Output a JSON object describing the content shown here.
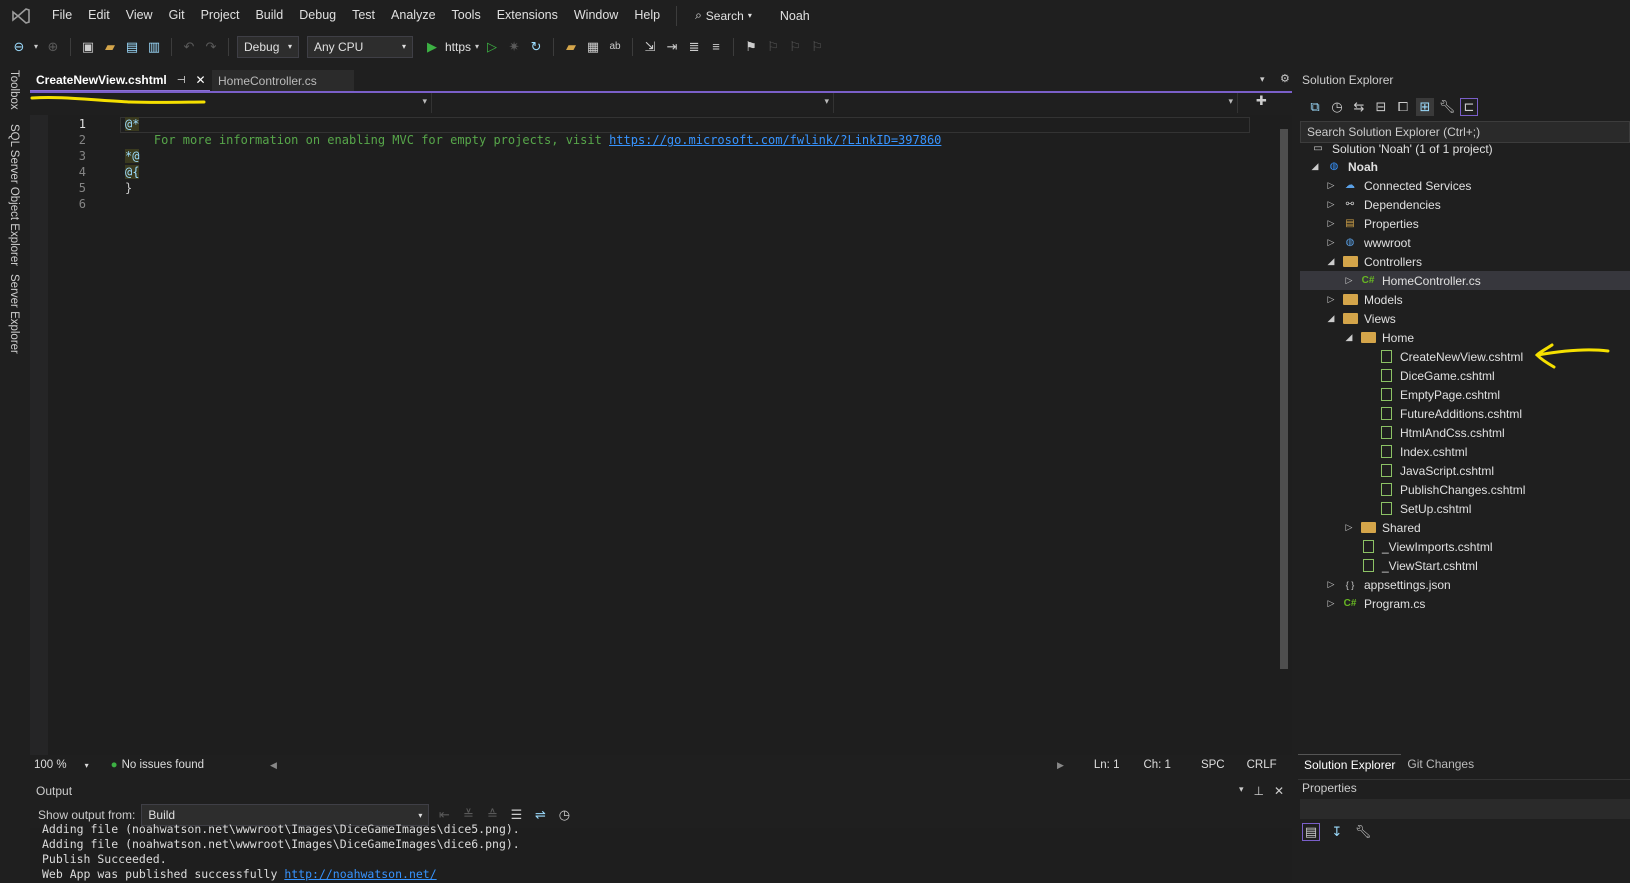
{
  "menubar": {
    "items": [
      "File",
      "Edit",
      "View",
      "Git",
      "Project",
      "Build",
      "Debug",
      "Test",
      "Analyze",
      "Tools",
      "Extensions",
      "Window",
      "Help"
    ],
    "search_label": "Search",
    "solution_name": "Noah"
  },
  "toolbar": {
    "config": "Debug",
    "platform": "Any CPU",
    "run_target": "https"
  },
  "left_tabs": [
    "Toolbox",
    "SQL Server Object Explorer",
    "Server Explorer"
  ],
  "editor": {
    "tabs": [
      {
        "label": "CreateNewView.cshtml",
        "active": true
      },
      {
        "label": "HomeController.cs",
        "active": false
      }
    ],
    "line_numbers": [
      "1",
      "2",
      "3",
      "4",
      "5",
      "6"
    ],
    "lines": {
      "l1": "@*",
      "l2_text": "    For more information on enabling MVC for empty projects, visit ",
      "l2_link": "https://go.microsoft.com/fwlink/?LinkID=397860",
      "l3": "*@",
      "l4": "@{",
      "l5": "}"
    },
    "status": {
      "zoom": "100 %",
      "issues": "No issues found",
      "line": "Ln: 1",
      "col": "Ch: 1",
      "whitespace": "SPC",
      "line_ending": "CRLF"
    }
  },
  "output": {
    "title": "Output",
    "show_from_label": "Show output from:",
    "source": "Build",
    "lines": [
      "Adding file (noahwatson.net\\wwwroot\\Images\\DiceGameImages\\dice5.png).",
      "Adding file (noahwatson.net\\wwwroot\\Images\\DiceGameImages\\dice6.png).",
      "Publish Succeeded.",
      "Web App was published successfully "
    ],
    "last_link": "http://noahwatson.net/"
  },
  "solution_explorer": {
    "title": "Solution Explorer",
    "search_placeholder": "Search Solution Explorer (Ctrl+;)",
    "solution_label": "Solution 'Noah' (1 of 1 project)",
    "project": "Noah",
    "nodes": {
      "connected": "Connected Services",
      "dependencies": "Dependencies",
      "properties": "Properties",
      "wwwroot": "wwwroot",
      "controllers": "Controllers",
      "homecontroller": "HomeController.cs",
      "models": "Models",
      "views": "Views",
      "home": "Home",
      "shared": "Shared",
      "viewimports": "_ViewImports.cshtml",
      "viewstart": "_ViewStart.cshtml",
      "appsettings": "appsettings.json",
      "program": "Program.cs"
    },
    "home_files": [
      "CreateNewView.cshtml",
      "DiceGame.cshtml",
      "EmptyPage.cshtml",
      "FutureAdditions.cshtml",
      "HtmlAndCss.cshtml",
      "Index.cshtml",
      "JavaScript.cshtml",
      "PublishChanges.cshtml",
      "SetUp.cshtml"
    ],
    "bottom_tabs": [
      "Solution Explorer",
      "Git Changes"
    ]
  },
  "properties_panel": {
    "title": "Properties"
  },
  "colors": {
    "accent": "#7a5fc9",
    "annotation": "#f5e000",
    "comment_green": "#57a64a",
    "link_blue": "#3794ff"
  }
}
